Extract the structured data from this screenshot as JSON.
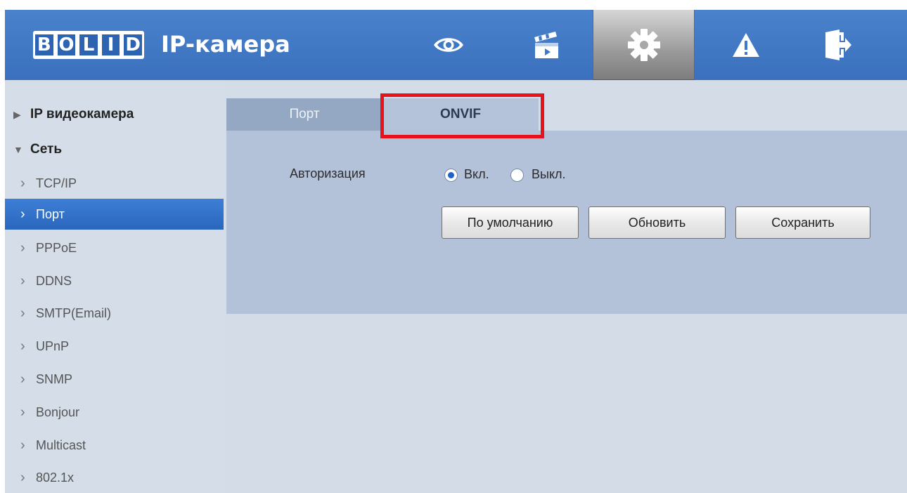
{
  "app": {
    "logo_letters": [
      "B",
      "O",
      "L",
      "I",
      "D"
    ],
    "title": "IP-камера"
  },
  "top_nav": {
    "items": [
      {
        "name": "live-view",
        "icon": "eye-icon"
      },
      {
        "name": "playback",
        "icon": "clapperboard-icon"
      },
      {
        "name": "setup",
        "icon": "gear-icon",
        "active": true
      },
      {
        "name": "alarm",
        "icon": "warning-icon"
      },
      {
        "name": "logout",
        "icon": "exit-icon"
      }
    ]
  },
  "sidebar": {
    "items": [
      {
        "type": "category",
        "label": "IP видеокамера",
        "expanded": false
      },
      {
        "type": "category",
        "label": "Сеть",
        "expanded": true
      },
      {
        "type": "sub",
        "label": "TCP/IP"
      },
      {
        "type": "sub",
        "label": "Порт",
        "selected": true
      },
      {
        "type": "sub",
        "label": "PPPoE"
      },
      {
        "type": "sub",
        "label": "DDNS"
      },
      {
        "type": "sub",
        "label": "SMTP(Email)"
      },
      {
        "type": "sub",
        "label": "UPnP"
      },
      {
        "type": "sub",
        "label": "SNMP"
      },
      {
        "type": "sub",
        "label": "Bonjour"
      },
      {
        "type": "sub",
        "label": "Multicast"
      },
      {
        "type": "sub",
        "label": "802.1x"
      }
    ]
  },
  "tabs": [
    {
      "label": "Порт",
      "active": false
    },
    {
      "label": "ONVIF",
      "active": true
    }
  ],
  "form": {
    "auth_label": "Авторизация",
    "options": [
      {
        "label": "Вкл.",
        "checked": true
      },
      {
        "label": "Выкл.",
        "checked": false
      }
    ]
  },
  "buttons": {
    "default": "По умолчанию",
    "refresh": "Обновить",
    "save": "Сохранить"
  },
  "colors": {
    "header": "#3f78c4",
    "highlight": "#e8121b",
    "selected": "#2f70c8"
  }
}
